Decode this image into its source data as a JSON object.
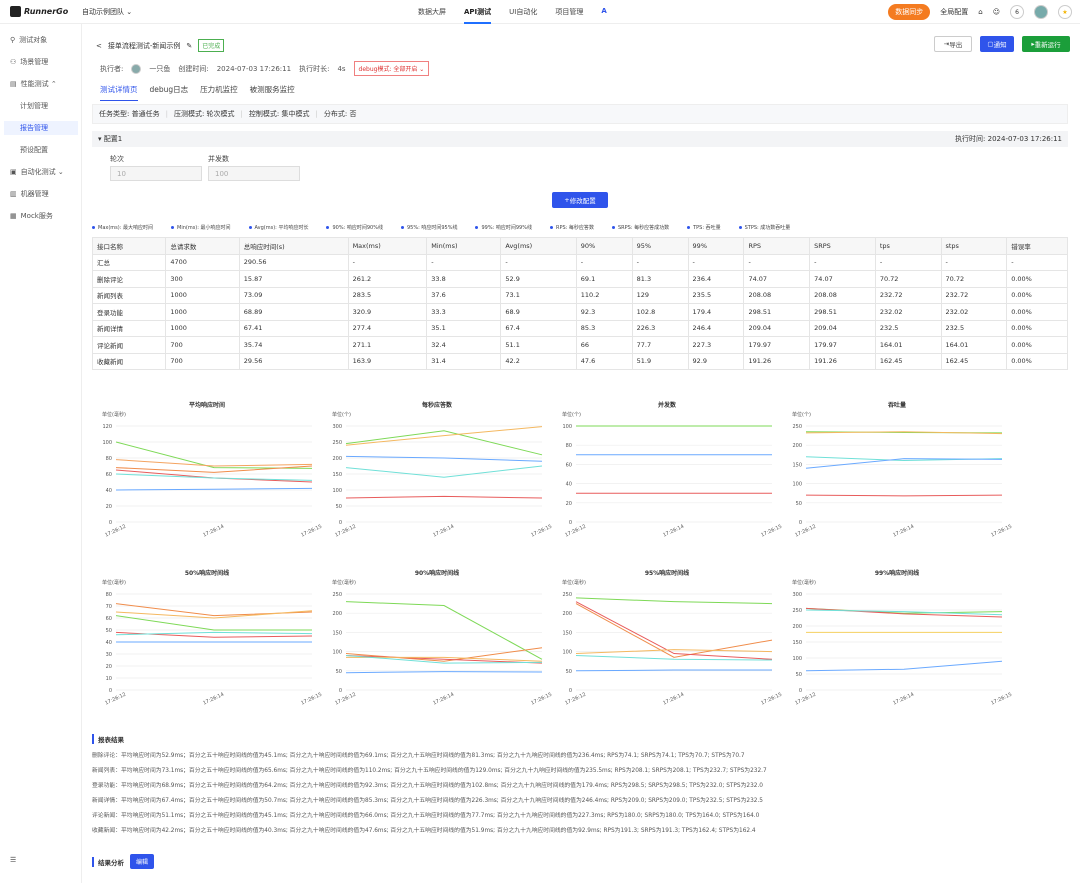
{
  "app": {
    "logo": "RunnerGo",
    "team": "自动示例团队 ⌄"
  },
  "topnav": [
    {
      "label": "数据大屏"
    },
    {
      "label": "API测试"
    },
    {
      "label": "UI自动化"
    },
    {
      "label": "项目管理"
    },
    {
      "label": "A"
    }
  ],
  "topright": {
    "sync": "数据同步",
    "global": "全局配置",
    "badge": "6"
  },
  "sidebar": [
    {
      "label": "测试对象",
      "sub": false
    },
    {
      "label": "场景管理",
      "sub": false
    },
    {
      "label": "性能测试 ⌃",
      "sub": false
    },
    {
      "label": "计划管理",
      "sub": true
    },
    {
      "label": "报告管理",
      "sub": true
    },
    {
      "label": "预设配置",
      "sub": true
    },
    {
      "label": "自动化测试 ⌄",
      "sub": false
    },
    {
      "label": "机器管理",
      "sub": false
    },
    {
      "label": "Mock服务",
      "sub": false
    }
  ],
  "header": {
    "back": "<",
    "title": "接单流程测试-新闻示例",
    "status": "已完成",
    "executor_label": "执行者:",
    "executor": "一只鱼",
    "created_label": "创建时间:",
    "created": "2024-07-03 17:26:11",
    "duration_label": "执行时长:",
    "duration": "4s",
    "debug": "debug模式: 全部开启 ⌄",
    "export": "导出",
    "notify": "通知",
    "rerun": "重新运行"
  },
  "tabs": [
    {
      "label": "测试详情页"
    },
    {
      "label": "debug日志"
    },
    {
      "label": "压力机监控"
    },
    {
      "label": "被测服务监控"
    }
  ],
  "taskinfo": [
    "任务类型: 普通任务",
    "压测模式: 轮次模式",
    "控制模式: 集中模式",
    "分布式: 否"
  ],
  "config": {
    "name": "配置1",
    "exec_time": "执行时间: 2024-07-03 17:26:11",
    "rounds_label": "轮次",
    "rounds": "10",
    "concurrency_label": "并发数",
    "concurrency": "100",
    "modify": "修改配置"
  },
  "legend": [
    "Max(ms): 最大响应时间",
    "Min(ms): 最小响应时间",
    "Avg(ms): 平均响应时长",
    "90%: 响应时间90%线",
    "95%: 响应时间95%线",
    "99%: 响应时间99%线",
    "RPS: 每秒应答数",
    "SRPS: 每秒应答成功数",
    "TPS: 吞吐量",
    "STPS: 成功数吞吐量"
  ],
  "table": {
    "headers": [
      "接口名称",
      "总请求数",
      "总响应时间(s)",
      "Max(ms)",
      "Min(ms)",
      "Avg(ms)",
      "90%",
      "95%",
      "99%",
      "RPS",
      "SRPS",
      "tps",
      "stps",
      "错误率"
    ],
    "rows": [
      [
        "汇总",
        "4700",
        "290.56",
        "-",
        "-",
        "-",
        "-",
        "-",
        "-",
        "-",
        "-",
        "-",
        "-",
        "-"
      ],
      [
        "删除评论",
        "300",
        "15.87",
        "261.2",
        "33.8",
        "52.9",
        "69.1",
        "81.3",
        "236.4",
        "74.07",
        "74.07",
        "70.72",
        "70.72",
        "0.00%"
      ],
      [
        "新闻列表",
        "1000",
        "73.09",
        "283.5",
        "37.6",
        "73.1",
        "110.2",
        "129",
        "235.5",
        "208.08",
        "208.08",
        "232.72",
        "232.72",
        "0.00%"
      ],
      [
        "登录功能",
        "1000",
        "68.89",
        "320.9",
        "33.3",
        "68.9",
        "92.3",
        "102.8",
        "179.4",
        "298.51",
        "298.51",
        "232.02",
        "232.02",
        "0.00%"
      ],
      [
        "新闻详情",
        "1000",
        "67.41",
        "277.4",
        "35.1",
        "67.4",
        "85.3",
        "226.3",
        "246.4",
        "209.04",
        "209.04",
        "232.5",
        "232.5",
        "0.00%"
      ],
      [
        "评论新闻",
        "700",
        "35.74",
        "271.1",
        "32.4",
        "51.1",
        "66",
        "77.7",
        "227.3",
        "179.97",
        "179.97",
        "164.01",
        "164.01",
        "0.00%"
      ],
      [
        "收藏新闻",
        "700",
        "29.56",
        "163.9",
        "31.4",
        "42.2",
        "47.6",
        "51.9",
        "92.9",
        "191.26",
        "191.26",
        "162.45",
        "162.45",
        "0.00%"
      ]
    ]
  },
  "chart_data": [
    {
      "type": "line",
      "title": "平均响应时间",
      "ylabel": "单位(毫秒)",
      "ylim": [
        0,
        120
      ],
      "yticks": [
        0,
        20,
        40,
        60,
        80,
        100,
        120
      ],
      "x": [
        "17:26:12",
        "17:26:14",
        "17:26:15"
      ],
      "series": [
        {
          "values": [
            100,
            68,
            67
          ],
          "color": "#7ed957"
        },
        {
          "values": [
            78,
            70,
            72
          ],
          "color": "#f4a460"
        },
        {
          "values": [
            68,
            62,
            70
          ],
          "color": "#f08c4a"
        },
        {
          "values": [
            65,
            55,
            50
          ],
          "color": "#e85c5c"
        },
        {
          "values": [
            60,
            55,
            52
          ],
          "color": "#70e0d8"
        },
        {
          "values": [
            40,
            41,
            42
          ],
          "color": "#6aa9ff"
        }
      ]
    },
    {
      "type": "line",
      "title": "每秒应答数",
      "ylabel": "单位(个)",
      "ylim": [
        0,
        300
      ],
      "yticks": [
        0,
        50,
        100,
        150,
        200,
        250,
        300
      ],
      "x": [
        "17:26:12",
        "17:26:14",
        "17:26:15"
      ],
      "series": [
        {
          "values": [
            245,
            285,
            210
          ],
          "color": "#7ed957"
        },
        {
          "values": [
            240,
            270,
            298
          ],
          "color": "#f4b860"
        },
        {
          "values": [
            205,
            200,
            190
          ],
          "color": "#6aa9ff"
        },
        {
          "values": [
            170,
            140,
            175
          ],
          "color": "#70e0d8"
        },
        {
          "values": [
            75,
            80,
            75
          ],
          "color": "#e85c5c"
        }
      ]
    },
    {
      "type": "line",
      "title": "并发数",
      "ylabel": "单位(个)",
      "ylim": [
        0,
        100
      ],
      "yticks": [
        0,
        20,
        40,
        60,
        80,
        100
      ],
      "x": [
        "17:26:12",
        "17:26:14",
        "17:26:15"
      ],
      "series": [
        {
          "values": [
            100,
            100,
            100
          ],
          "color": "#7ed957"
        },
        {
          "values": [
            70,
            70,
            70
          ],
          "color": "#6aa9ff"
        },
        {
          "values": [
            30,
            30,
            30
          ],
          "color": "#e85c5c"
        }
      ]
    },
    {
      "type": "line",
      "title": "吞吐量",
      "ylabel": "单位(个)",
      "ylim": [
        0,
        250
      ],
      "yticks": [
        0,
        50,
        100,
        150,
        200,
        250
      ],
      "x": [
        "17:26:12",
        "17:26:14",
        "17:26:15"
      ],
      "series": [
        {
          "values": [
            235,
            233,
            232
          ],
          "color": "#7ed957"
        },
        {
          "values": [
            232,
            235,
            230
          ],
          "color": "#f4b860"
        },
        {
          "values": [
            170,
            160,
            165
          ],
          "color": "#70e0d8"
        },
        {
          "values": [
            140,
            165,
            163
          ],
          "color": "#6aa9ff"
        },
        {
          "values": [
            70,
            68,
            70
          ],
          "color": "#e85c5c"
        }
      ]
    },
    {
      "type": "line",
      "title": "50%响应时间线",
      "ylabel": "单位(毫秒)",
      "ylim": [
        0,
        80
      ],
      "yticks": [
        0,
        10,
        20,
        30,
        40,
        50,
        60,
        70,
        80
      ],
      "x": [
        "17:26:12",
        "17:26:14",
        "17:26:15"
      ],
      "series": [
        {
          "values": [
            72,
            62,
            65
          ],
          "color": "#f08c4a"
        },
        {
          "values": [
            65,
            60,
            66
          ],
          "color": "#f4b860"
        },
        {
          "values": [
            62,
            50,
            50
          ],
          "color": "#7ed957"
        },
        {
          "values": [
            48,
            44,
            45
          ],
          "color": "#e85c5c"
        },
        {
          "values": [
            46,
            48,
            47
          ],
          "color": "#70e0d8"
        },
        {
          "values": [
            40,
            40,
            40
          ],
          "color": "#6aa9ff"
        }
      ]
    },
    {
      "type": "line",
      "title": "90%响应时间线",
      "ylabel": "单位(毫秒)",
      "ylim": [
        0,
        250
      ],
      "yticks": [
        0,
        50,
        100,
        150,
        200,
        250
      ],
      "x": [
        "17:26:12",
        "17:26:14",
        "17:26:15"
      ],
      "series": [
        {
          "values": [
            230,
            220,
            80
          ],
          "color": "#7ed957"
        },
        {
          "values": [
            95,
            75,
            110
          ],
          "color": "#f08c4a"
        },
        {
          "values": [
            90,
            80,
            70
          ],
          "color": "#e85c5c"
        },
        {
          "values": [
            85,
            85,
            75
          ],
          "color": "#f4b860"
        },
        {
          "values": [
            90,
            70,
            72
          ],
          "color": "#70e0d8"
        },
        {
          "values": [
            45,
            48,
            47
          ],
          "color": "#6aa9ff"
        }
      ]
    },
    {
      "type": "line",
      "title": "95%响应时间线",
      "ylabel": "单位(毫秒)",
      "ylim": [
        0,
        250
      ],
      "yticks": [
        0,
        50,
        100,
        150,
        200,
        250
      ],
      "x": [
        "17:26:12",
        "17:26:14",
        "17:26:15"
      ],
      "series": [
        {
          "values": [
            240,
            230,
            225
          ],
          "color": "#7ed957"
        },
        {
          "values": [
            225,
            85,
            130
          ],
          "color": "#f08c4a"
        },
        {
          "values": [
            230,
            95,
            80
          ],
          "color": "#e85c5c"
        },
        {
          "values": [
            95,
            105,
            100
          ],
          "color": "#f4b860"
        },
        {
          "values": [
            90,
            80,
            78
          ],
          "color": "#70e0d8"
        },
        {
          "values": [
            50,
            52,
            52
          ],
          "color": "#6aa9ff"
        }
      ]
    },
    {
      "type": "line",
      "title": "99%响应时间线",
      "ylabel": "单位(毫秒)",
      "ylim": [
        0,
        300
      ],
      "yticks": [
        0,
        50,
        100,
        150,
        200,
        250,
        300
      ],
      "x": [
        "17:26:12",
        "17:26:14",
        "17:26:15"
      ],
      "series": [
        {
          "values": [
            255,
            240,
            245
          ],
          "color": "#7ed957"
        },
        {
          "values": [
            255,
            238,
            228
          ],
          "color": "#e85c5c"
        },
        {
          "values": [
            250,
            245,
            235
          ],
          "color": "#70e0d8"
        },
        {
          "values": [
            180,
            180,
            180
          ],
          "color": "#f4d060"
        },
        {
          "values": [
            60,
            65,
            90
          ],
          "color": "#6aa9ff"
        }
      ]
    }
  ],
  "summary": {
    "title": "报表结果",
    "lines": [
      "删除评论：平均响应时间为52.9ms；百分之五十响应时间线的值为45.1ms; 百分之九十响应时间线的值为69.1ms; 百分之九十五响应时间线的值为81.3ms; 百分之九十九响应时间线的值为236.4ms; RPS为74.1; SRPS为74.1; TPS为70.7; STPS为70.7",
      "新闻列表：平均响应时间为73.1ms；百分之五十响应时间线的值为65.6ms; 百分之九十响应时间线的值为110.2ms; 百分之九十五响应时间线的值为129.0ms; 百分之九十九响应时间线的值为235.5ms; RPS为208.1; SRPS为208.1; TPS为232.7; STPS为232.7",
      "登录功能：平均响应时间为68.9ms；百分之五十响应时间线的值为64.2ms; 百分之九十响应时间线的值为92.3ms; 百分之九十五响应时间线的值为102.8ms; 百分之九十九响应时间线的值为179.4ms; RPS为298.5; SRPS为298.5; TPS为232.0; STPS为232.0",
      "新闻详情：平均响应时间为67.4ms；百分之五十响应时间线的值为50.7ms; 百分之九十响应时间线的值为85.3ms; 百分之九十五响应时间线的值为226.3ms; 百分之九十九响应时间线的值为246.4ms; RPS为209.0; SRPS为209.0; TPS为232.5; STPS为232.5",
      "评论新闻：平均响应时间为51.1ms；百分之五十响应时间线的值为45.1ms; 百分之九十响应时间线的值为66.0ms; 百分之九十五响应时间线的值为77.7ms; 百分之九十九响应时间线的值为227.3ms; RPS为180.0; SRPS为180.0; TPS为164.0; STPS为164.0",
      "收藏新闻：平均响应时间为42.2ms；百分之五十响应时间线的值为40.3ms; 百分之九十响应时间线的值为47.6ms; 百分之九十五响应时间线的值为51.9ms; 百分之九十九响应时间线的值为92.9ms; RPS为191.3; SRPS为191.3; TPS为162.4; STPS为162.4"
    ]
  },
  "analysis": {
    "label": "结果分析",
    "edit": "编辑"
  }
}
